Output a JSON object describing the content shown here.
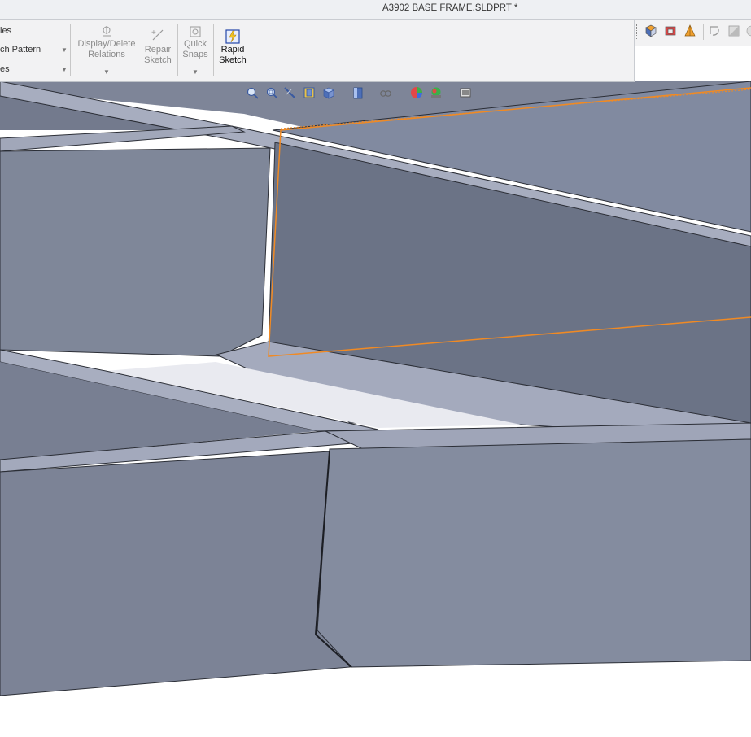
{
  "window": {
    "title": "A3902 BASE FRAME.SLDPRT *"
  },
  "ribbon": {
    "partial_items": [
      "ies",
      "ch Pattern",
      "es"
    ],
    "display_delete_relations": {
      "line1": "Display/Delete",
      "line2": "Relations"
    },
    "repair_sketch": {
      "line1": "Repair",
      "line2": "Sketch"
    },
    "quick_snaps": {
      "line1": "Quick",
      "line2": "Snaps"
    },
    "rapid_sketch": {
      "line1": "Rapid",
      "line2": "Sketch"
    }
  },
  "right_toolbar": {
    "icons": [
      "view-orientation-icon",
      "section-view-icon",
      "display-style-icon",
      "rotate-icon",
      "normal-to-icon",
      "appearance-icon"
    ]
  },
  "heads_up_toolbar": {
    "icons": [
      "zoom-to-fit-icon",
      "zoom-to-area-icon",
      "previous-view-icon",
      "section-view-icon",
      "view-orientation-icon",
      "display-style-icon",
      "hide-show-items-icon",
      "edit-appearance-icon",
      "apply-scene-icon",
      "view-settings-icon"
    ]
  },
  "colors": {
    "sketch_highlight": "#f08a24",
    "steel": "#858da0",
    "steel_dark": "#6b7386",
    "steel_light": "#a7adbf"
  }
}
